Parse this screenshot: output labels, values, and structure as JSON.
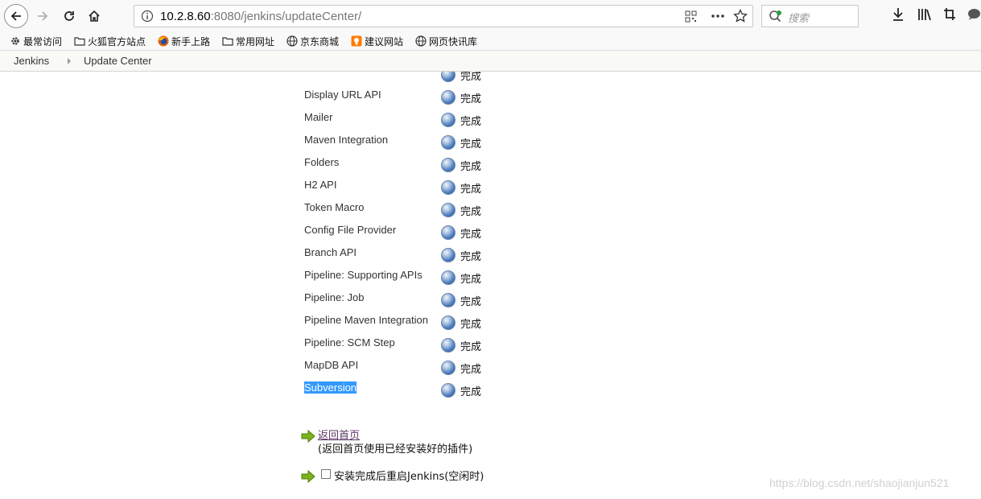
{
  "browser": {
    "url_host": "10.2.8.60",
    "url_rest": ":8080/jenkins/updateCenter/",
    "search_placeholder": "搜索",
    "icons": [
      "back-icon",
      "forward-icon",
      "reload-icon",
      "home-icon",
      "info-icon",
      "qr-icon",
      "more-icon",
      "star-icon",
      "download-icon",
      "library-icon",
      "screenshot-icon",
      "chat-icon"
    ]
  },
  "bookmarks": [
    {
      "label": "最常访问",
      "icon": "gear-icon"
    },
    {
      "label": "火狐官方站点",
      "icon": "folder-icon"
    },
    {
      "label": "新手上路",
      "icon": "firefox-icon"
    },
    {
      "label": "常用网址",
      "icon": "folder-icon"
    },
    {
      "label": "京东商城",
      "icon": "globe-icon"
    },
    {
      "label": "建议网站",
      "icon": "bulb-icon"
    },
    {
      "label": "网页快讯库",
      "icon": "globe-icon"
    }
  ],
  "breadcrumb": {
    "root": "Jenkins",
    "current": "Update Center"
  },
  "plugins": [
    {
      "name": "",
      "status": "完成"
    },
    {
      "name": "Display URL API",
      "status": "完成"
    },
    {
      "name": "Mailer",
      "status": "完成"
    },
    {
      "name": "Maven Integration",
      "status": "完成"
    },
    {
      "name": "Folders",
      "status": "完成"
    },
    {
      "name": "H2 API",
      "status": "完成"
    },
    {
      "name": "Token Macro",
      "status": "完成"
    },
    {
      "name": "Config File Provider",
      "status": "完成"
    },
    {
      "name": "Branch API",
      "status": "完成"
    },
    {
      "name": "Pipeline: Supporting APIs",
      "status": "完成"
    },
    {
      "name": "Pipeline: Job",
      "status": "完成"
    },
    {
      "name": "Pipeline Maven Integration",
      "status": "完成"
    },
    {
      "name": "Pipeline: SCM Step",
      "status": "完成"
    },
    {
      "name": "MapDB API",
      "status": "完成"
    },
    {
      "name": "Subversion",
      "status": "完成",
      "selected": true
    }
  ],
  "actions": {
    "home_link": "返回首页",
    "home_desc": "(返回首页使用已经安装好的插件)",
    "restart_label": "安装完成后重启Jenkins(空闲时)"
  },
  "watermark": "https://blog.csdn.net/shaojianjun521"
}
